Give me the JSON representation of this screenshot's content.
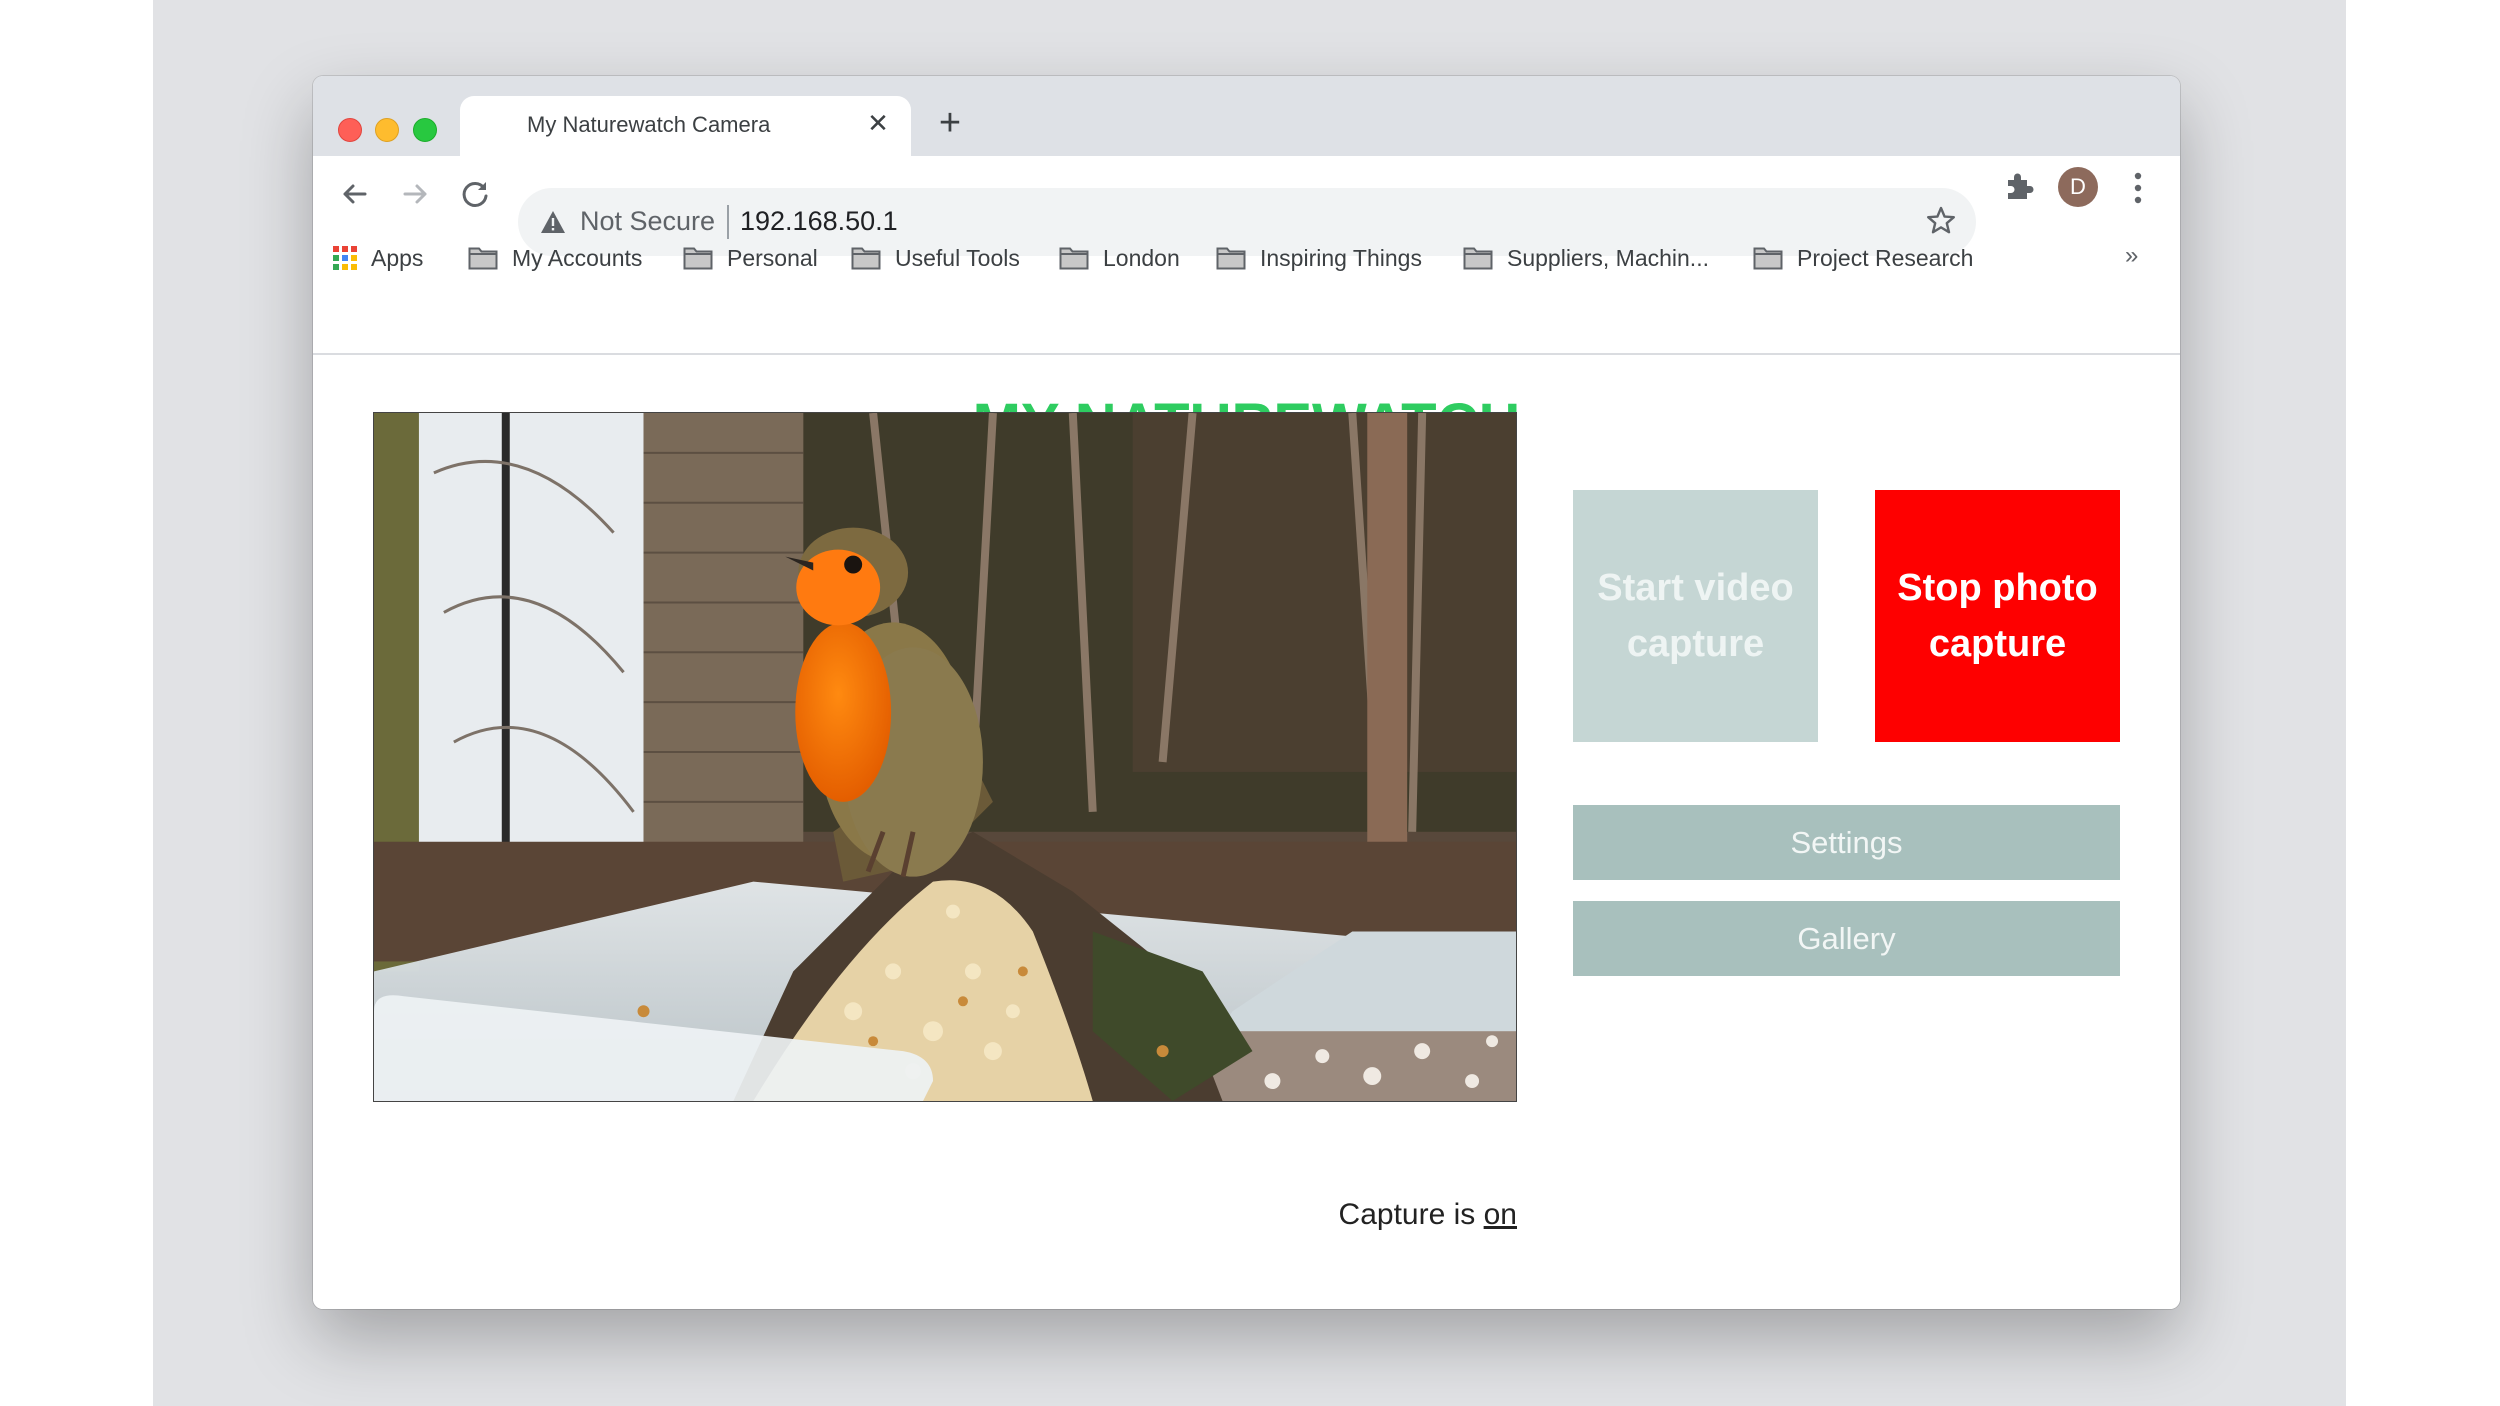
{
  "browser": {
    "tab": {
      "title": "My Naturewatch Camera",
      "close_icon": "close-icon"
    },
    "new_tab_icon": "plus-icon",
    "address_bar": {
      "security_label": "Not Secure",
      "url": "192.168.50.1"
    },
    "profile_initial": "D",
    "bookmarks": [
      {
        "label": "Apps",
        "icon": "apps-grid-icon"
      },
      {
        "label": "My Accounts",
        "icon": "folder-icon"
      },
      {
        "label": "Personal",
        "icon": "folder-icon"
      },
      {
        "label": "Useful Tools",
        "icon": "folder-icon"
      },
      {
        "label": "London",
        "icon": "folder-icon"
      },
      {
        "label": "Inspiring Things",
        "icon": "folder-icon"
      },
      {
        "label": "Suppliers, Machin...",
        "icon": "folder-icon"
      },
      {
        "label": "Project Research",
        "icon": "folder-icon"
      }
    ],
    "bookmarks_overflow": "»"
  },
  "page": {
    "title": "MY NATUREWATCH",
    "title_color": "#2ecc60",
    "camera_feed_alt": "Live camera feed: robin perched on log with bird seed in water tray",
    "buttons": {
      "start_video": "Start video capture",
      "stop_photo": "Stop photo capture",
      "settings": "Settings",
      "gallery": "Gallery"
    },
    "button_colors": {
      "start_video": "#c5d6d4",
      "stop_photo": "#fe0000",
      "nav": "#a8c0bd"
    },
    "capture_status": {
      "prefix": "Capture is ",
      "state": "on"
    }
  }
}
